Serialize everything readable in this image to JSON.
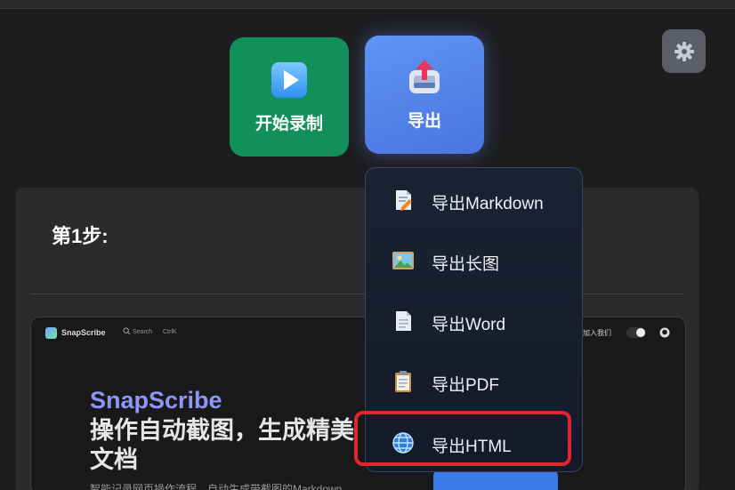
{
  "toolbar": {
    "record_label": "开始录制",
    "export_label": "导出"
  },
  "step": {
    "title": "第1步:"
  },
  "export_menu": {
    "items": [
      {
        "label": "导出Markdown",
        "icon": "markdown-file-icon"
      },
      {
        "label": "导出长图",
        "icon": "image-icon"
      },
      {
        "label": "导出Word",
        "icon": "document-icon"
      },
      {
        "label": "导出PDF",
        "icon": "clipboard-icon"
      },
      {
        "label": "导出HTML",
        "icon": "globe-icon"
      }
    ],
    "highlighted": "导出HTML"
  },
  "preview": {
    "brand": "SnapScribe",
    "search_placeholder": "Search",
    "search_shortcut": "CtrlK",
    "join_label": "加入我们",
    "headline_brand": "SnapScribe",
    "headline": "操作自动截图，生成精美文档",
    "description": "智能记录网页操作流程，自动生成带截图的Markdown"
  },
  "colors": {
    "record_button": "#12905c",
    "export_button": "#5a86ec",
    "highlight": "#e3262d"
  }
}
